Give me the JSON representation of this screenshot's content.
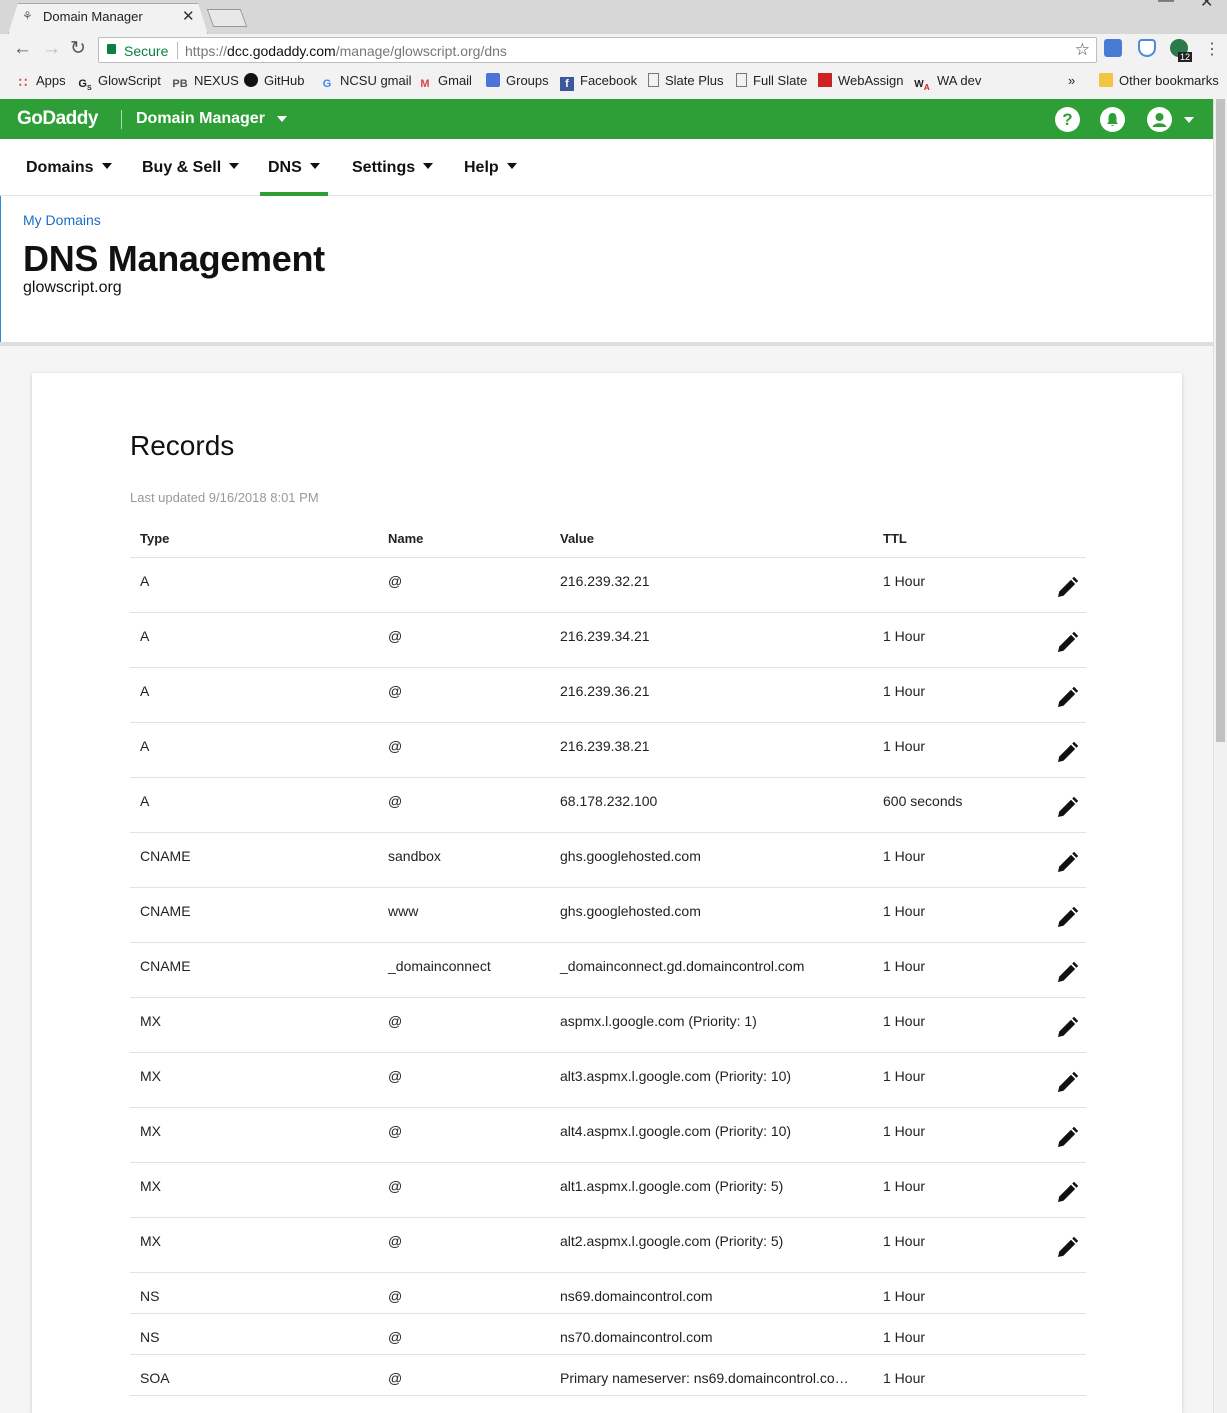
{
  "browser": {
    "tab_title": "Domain Manager",
    "secure_label": "Secure",
    "url_prefix": "https://",
    "url_host": "dcc.godaddy.com",
    "url_path": "/manage/glowscript.org/dns",
    "extension_badge": "12",
    "bookmarks": [
      {
        "label": "Apps",
        "icon": "apps-grid-icon"
      },
      {
        "label": "GlowScript",
        "icon": "glowscript-icon"
      },
      {
        "label": "NEXUS",
        "icon": "pb-icon"
      },
      {
        "label": "GitHub",
        "icon": "github-icon"
      },
      {
        "label": "NCSU gmail",
        "icon": "google-icon"
      },
      {
        "label": "Gmail",
        "icon": "gmail-icon"
      },
      {
        "label": "Groups",
        "icon": "groups-icon"
      },
      {
        "label": "Facebook",
        "icon": "facebook-icon"
      },
      {
        "label": "Slate Plus",
        "icon": "page-icon"
      },
      {
        "label": "Full Slate",
        "icon": "page-icon"
      },
      {
        "label": "WebAssign",
        "icon": "webassign-icon"
      },
      {
        "label": "WA dev",
        "icon": "wa-icon"
      }
    ],
    "overflow_label": "»",
    "other_bookmarks": "Other bookmarks"
  },
  "header": {
    "logo": "GoDaddy",
    "product": "Domain Manager",
    "help_glyph": "?"
  },
  "nav": [
    {
      "label": "Domains"
    },
    {
      "label": "Buy & Sell"
    },
    {
      "label": "DNS"
    },
    {
      "label": "Settings"
    },
    {
      "label": "Help"
    }
  ],
  "page": {
    "breadcrumb": "My Domains",
    "title": "DNS Management",
    "domain": "glowscript.org"
  },
  "records": {
    "title": "Records",
    "last_updated": "Last updated 9/16/2018 8:01 PM",
    "columns": [
      "Type",
      "Name",
      "Value",
      "TTL"
    ],
    "rows": [
      {
        "type": "A",
        "name": "@",
        "value": "216.239.32.21",
        "ttl": "1 Hour",
        "editable": true
      },
      {
        "type": "A",
        "name": "@",
        "value": "216.239.34.21",
        "ttl": "1 Hour",
        "editable": true
      },
      {
        "type": "A",
        "name": "@",
        "value": "216.239.36.21",
        "ttl": "1 Hour",
        "editable": true
      },
      {
        "type": "A",
        "name": "@",
        "value": "216.239.38.21",
        "ttl": "1 Hour",
        "editable": true
      },
      {
        "type": "A",
        "name": "@",
        "value": "68.178.232.100",
        "ttl": "600 seconds",
        "editable": true
      },
      {
        "type": "CNAME",
        "name": "sandbox",
        "value": "ghs.googlehosted.com",
        "ttl": "1 Hour",
        "editable": true
      },
      {
        "type": "CNAME",
        "name": "www",
        "value": "ghs.googlehosted.com",
        "ttl": "1 Hour",
        "editable": true
      },
      {
        "type": "CNAME",
        "name": "_domainconnect",
        "value": "_domainconnect.gd.domaincontrol.com",
        "ttl": "1 Hour",
        "editable": true
      },
      {
        "type": "MX",
        "name": "@",
        "value": "aspmx.l.google.com (Priority: 1)",
        "ttl": "1 Hour",
        "editable": true
      },
      {
        "type": "MX",
        "name": "@",
        "value": "alt3.aspmx.l.google.com (Priority: 10)",
        "ttl": "1 Hour",
        "editable": true
      },
      {
        "type": "MX",
        "name": "@",
        "value": "alt4.aspmx.l.google.com (Priority: 10)",
        "ttl": "1 Hour",
        "editable": true
      },
      {
        "type": "MX",
        "name": "@",
        "value": "alt1.aspmx.l.google.com (Priority: 5)",
        "ttl": "1 Hour",
        "editable": true
      },
      {
        "type": "MX",
        "name": "@",
        "value": "alt2.aspmx.l.google.com (Priority: 5)",
        "ttl": "1 Hour",
        "editable": true
      },
      {
        "type": "NS",
        "name": "@",
        "value": "ns69.domaincontrol.com",
        "ttl": "1 Hour",
        "editable": false
      },
      {
        "type": "NS",
        "name": "@",
        "value": "ns70.domaincontrol.com",
        "ttl": "1 Hour",
        "editable": false
      },
      {
        "type": "SOA",
        "name": "@",
        "value": "Primary nameserver: ns69.domaincontrol.co…",
        "ttl": "1 Hour",
        "editable": false
      }
    ]
  },
  "colors": {
    "brand_green": "#2e9f36",
    "link_blue": "#1a6fc4"
  }
}
